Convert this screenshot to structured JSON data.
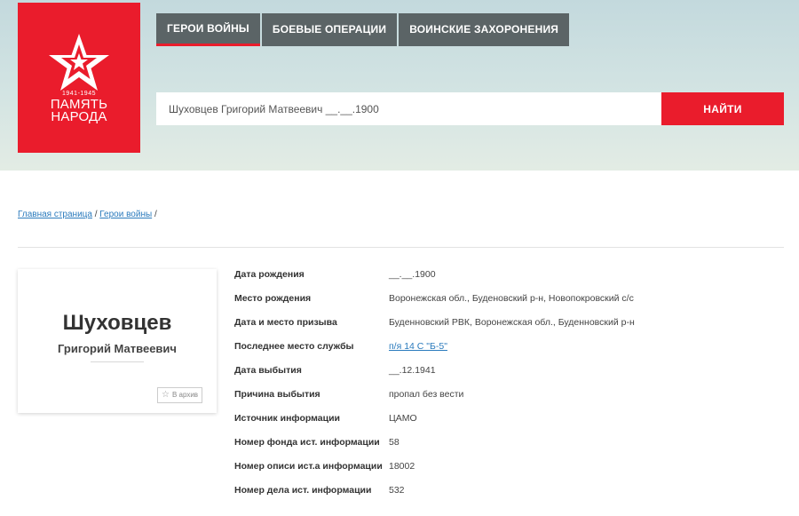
{
  "logo": {
    "years": "1941-1945",
    "line1": "ПАМЯТЬ",
    "line2": "НАРОДА"
  },
  "nav": {
    "items": [
      {
        "label": "ГЕРОИ ВОЙНЫ",
        "active": true
      },
      {
        "label": "БОЕВЫЕ ОПЕРАЦИИ",
        "active": false
      },
      {
        "label": "ВОИНСКИЕ ЗАХОРОНЕНИЯ",
        "active": false
      }
    ]
  },
  "search": {
    "value": "Шуховцев Григорий Матвеевич __.__.1900",
    "button_label": "НАЙТИ"
  },
  "breadcrumb": {
    "home": "Главная страница",
    "heroes": "Герои войны",
    "separator": "/"
  },
  "card": {
    "surname": "Шуховцев",
    "given_names": "Григорий Матвеевич",
    "archive_label": "В архив"
  },
  "details": {
    "rows": [
      {
        "label": "Дата рождения",
        "value": "__.__.1900"
      },
      {
        "label": "Место рождения",
        "value": "Воронежская обл., Буденовский р-н, Новопокровский с/с"
      },
      {
        "label": "Дата и место призыва",
        "value": "Буденновский РВК, Воронежская обл., Буденновский р-н"
      },
      {
        "label": "Последнее место службы",
        "value": "п/я 14 С \"Б-5\"",
        "link": true
      },
      {
        "label": "Дата выбытия",
        "value": "__.12.1941"
      },
      {
        "label": "Причина выбытия",
        "value": "пропал без вести"
      },
      {
        "label": "Источник информации",
        "value": "ЦАМО"
      },
      {
        "label": "Номер фонда ист. информации",
        "value": "58"
      },
      {
        "label": "Номер описи ист.а информации",
        "value": "18002"
      },
      {
        "label": "Номер дела ист. информации",
        "value": "532"
      }
    ]
  },
  "colors": {
    "brand_red": "#ea1c2c",
    "nav_bg": "#5b6466",
    "link": "#2b7bbd"
  }
}
